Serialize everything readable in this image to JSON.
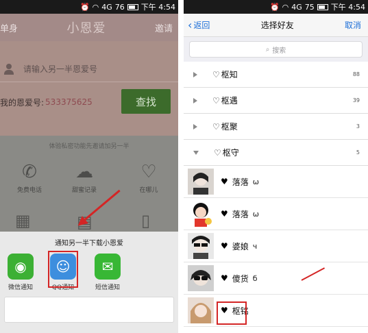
{
  "left_screen": {
    "status": {
      "signal": "4G",
      "battery": "76",
      "time": "下午 4:54"
    },
    "topbar": {
      "left": "单身",
      "title": "小恩爱",
      "right": "邀请"
    },
    "input_placeholder": "请输入另一半恩爱号",
    "my_number_label": "我的恩爱号:",
    "my_number_value": "533375625",
    "find_button": "查找",
    "hint": "体验私密功能先邀请加另一半",
    "features": [
      {
        "label": "免费电话",
        "icon": "phone-icon"
      },
      {
        "label": "甜蜜记录",
        "icon": "cloud-icon"
      },
      {
        "label": "在哪儿",
        "icon": "location-heart-icon"
      }
    ],
    "share_sheet": {
      "title": "通知另一半下载小恩爱",
      "items": [
        {
          "label": "微信通知",
          "icon": "wechat-icon",
          "color": "#3cb034"
        },
        {
          "label": "QQ通知",
          "icon": "qq-icon",
          "color": "#3d8ede"
        },
        {
          "label": "短信通知",
          "icon": "sms-icon",
          "color": "#38b735"
        }
      ]
    }
  },
  "right_screen": {
    "status": {
      "signal": "4G",
      "battery": "75",
      "time": "下午 4:54"
    },
    "nav": {
      "back": "返回",
      "title": "选择好友",
      "cancel": "取消"
    },
    "search_placeholder": "搜索",
    "groups": [
      {
        "label": "枢知",
        "count": "88",
        "expanded": false
      },
      {
        "label": "枢遇",
        "count": "39",
        "expanded": false
      },
      {
        "label": "枢聚",
        "count": "3",
        "expanded": false
      },
      {
        "label": "枢守",
        "count": "5",
        "expanded": true
      }
    ],
    "friends": [
      {
        "name": "落落",
        "suffix": "ω"
      },
      {
        "name": "落落",
        "suffix": "ω"
      },
      {
        "name": "婆娘",
        "suffix": "ч"
      },
      {
        "name": "傻货",
        "suffix": "б"
      },
      {
        "name": "枢铭",
        "suffix": ""
      }
    ],
    "accent": "#1d6fd8",
    "highlight": "#d42525"
  }
}
